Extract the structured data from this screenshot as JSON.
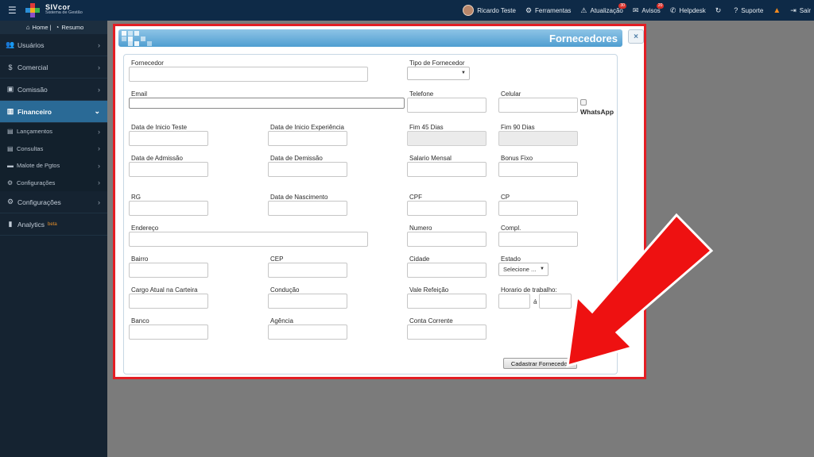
{
  "topbar": {
    "brand_name": "SIVcor",
    "brand_sub": "Sistema de Gestão",
    "user": "Ricardo Teste",
    "ferramentas": "Ferramentas",
    "atualizacao": "Atualização",
    "atualizacao_badge": "30",
    "avisos": "Avisos",
    "avisos_badge": "20",
    "helpdesk": "Helpdesk",
    "suporte": "Suporte",
    "sair": "Sair"
  },
  "sidebar": {
    "home": "Home",
    "resumo": "Resumo",
    "items": [
      {
        "label": "Usuários"
      },
      {
        "label": "Comercial"
      },
      {
        "label": "Comissão"
      },
      {
        "label": "Financeiro"
      }
    ],
    "sub": [
      {
        "label": "Lançamentos"
      },
      {
        "label": "Consultas"
      },
      {
        "label": "Malote de Pgtos"
      },
      {
        "label": "Configurações"
      }
    ],
    "configuracoes": "Configurações",
    "analytics": "Analytics",
    "beta": "beta"
  },
  "modal": {
    "title": "Fornecedores",
    "close": "×",
    "fields": {
      "fornecedor": "Fornecedor",
      "tipo": "Tipo de Fornecedor",
      "email": "Email",
      "telefone": "Telefone",
      "celular": "Celular",
      "whatsapp": "WhatsApp",
      "inicio_teste": "Data de Inicio Teste",
      "inicio_exp": "Data de Inicio Experiência",
      "fim45": "Fim 45 Dias",
      "fim90": "Fim 90 Dias",
      "admissao": "Data de Admissão",
      "demissao": "Data de Demissão",
      "salario": "Salario Mensal",
      "bonus": "Bonus Fixo",
      "rg": "RG",
      "nascimento": "Data de Nascimento",
      "cpf": "CPF",
      "cp": "CP",
      "endereco": "Endereço",
      "numero": "Numero",
      "compl": "Compl.",
      "bairro": "Bairro",
      "cep": "CEP",
      "cidade": "Cidade",
      "estado": "Estado",
      "cargo": "Cargo Atual na Carteira",
      "conducao": "Condução",
      "vale": "Vale Refeição",
      "horario": "Horario de trabalho:",
      "horario_sep": "á",
      "banco": "Banco",
      "agencia": "Agência",
      "conta": "Conta Corrente"
    },
    "estado_value": "Selecione ...",
    "submit": "Cadastrar Fornecedor"
  },
  "colors": {
    "highlight_border": "#e31e24",
    "arrow": "#ee1111",
    "sidebar_active": "#2a6a96",
    "topbar": "#0e2a47"
  }
}
